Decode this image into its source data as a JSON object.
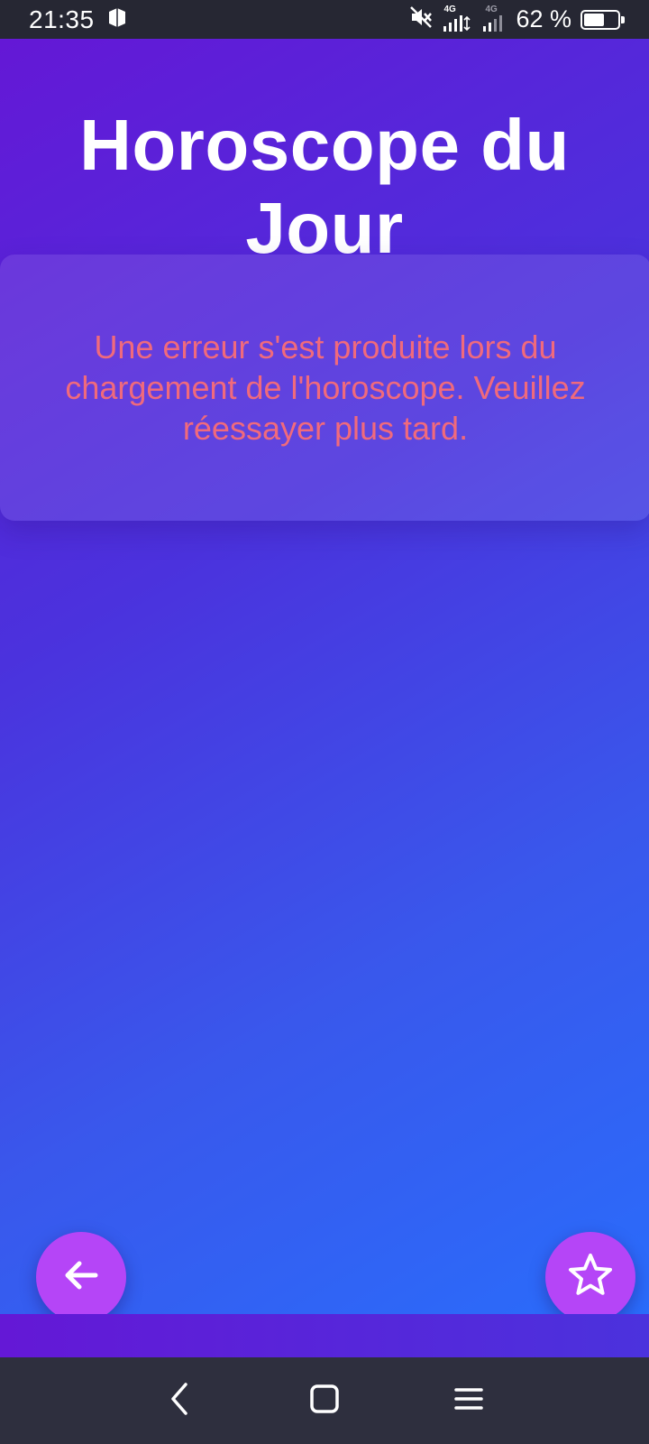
{
  "status_bar": {
    "time": "21:35",
    "network_label_1": "4G",
    "network_label_2": "4G",
    "battery_percent": "62 %",
    "battery_level": 0.62
  },
  "app": {
    "title": "Horoscope du Jour",
    "error_message": "Une erreur s'est produite lors du chargement de l'horoscope. Veuillez réessayer plus tard.",
    "buttons": {
      "back_icon": "arrow-left-icon",
      "favorite_icon": "star-outline-icon"
    },
    "colors": {
      "gradient_start": "#6418d6",
      "gradient_end": "#2a6cfb",
      "fab": "#b545f7",
      "error_text": "#f06a7c"
    }
  },
  "nav_bar": {
    "back_icon": "chevron-left-icon",
    "home_icon": "square-home-icon",
    "recents_icon": "hamburger-menu-icon"
  }
}
